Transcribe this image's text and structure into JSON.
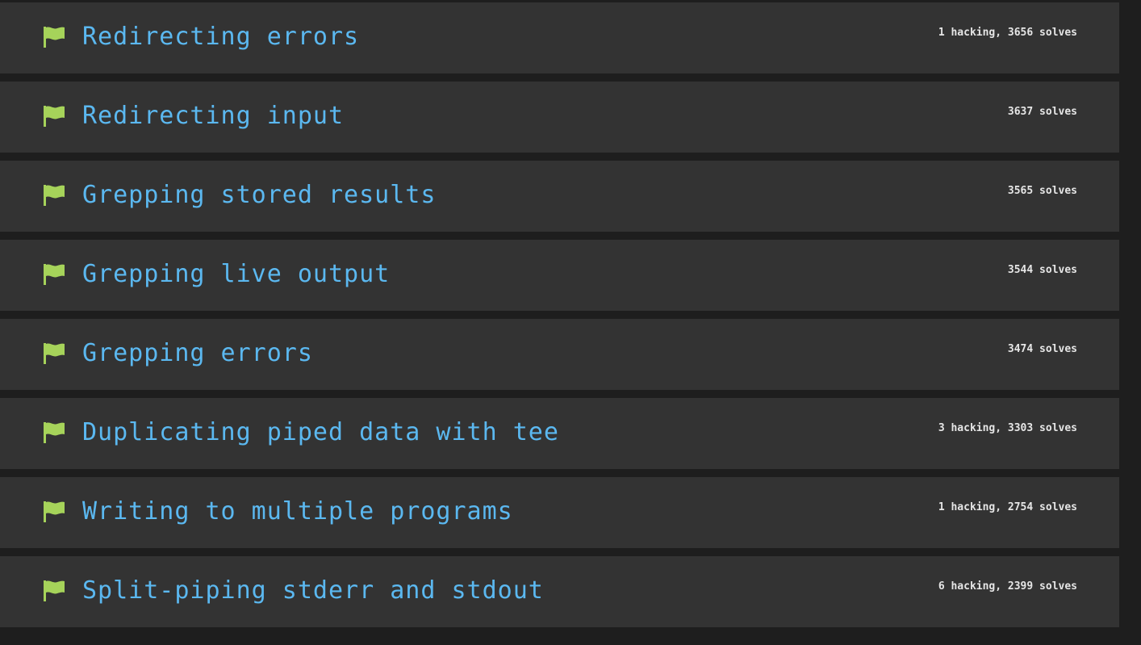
{
  "colors": {
    "page_background": "#1e1e1e",
    "row_background": "#333333",
    "title": "#5bb8f0",
    "flag": "#a6d35a",
    "meta": "#e6e6e6"
  },
  "challenges": [
    {
      "title": "Redirecting errors",
      "stats": "1 hacking, 3656 solves",
      "icon": "flag-icon"
    },
    {
      "title": "Redirecting input",
      "stats": "3637 solves",
      "icon": "flag-icon"
    },
    {
      "title": "Grepping stored results",
      "stats": "3565 solves",
      "icon": "flag-icon"
    },
    {
      "title": "Grepping live output",
      "stats": "3544 solves",
      "icon": "flag-icon"
    },
    {
      "title": "Grepping errors",
      "stats": "3474 solves",
      "icon": "flag-icon"
    },
    {
      "title": "Duplicating piped data with tee",
      "stats": "3 hacking, 3303 solves",
      "icon": "flag-icon"
    },
    {
      "title": "Writing to multiple programs",
      "stats": "1 hacking, 2754 solves",
      "icon": "flag-icon"
    },
    {
      "title": "Split-piping stderr and stdout",
      "stats": "6 hacking, 2399 solves",
      "icon": "flag-icon"
    }
  ]
}
